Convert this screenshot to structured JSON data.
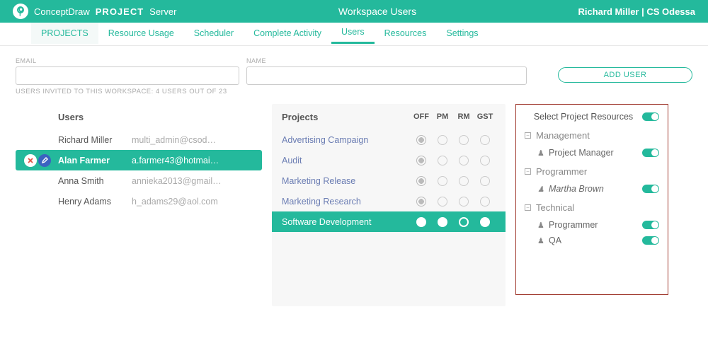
{
  "brand": {
    "left": "ConceptDraw",
    "mid": "PROJECT",
    "right": "Server"
  },
  "page_title": "Workspace Users",
  "current_user": "Richard Miller | CS Odessa",
  "tabs": [
    "PROJECTS",
    "Resource Usage",
    "Scheduler",
    "Complete Activity",
    "Users",
    "Resources",
    "Settings"
  ],
  "labels": {
    "email": "EMAIL",
    "name": "NAME",
    "add_user": "ADD USER"
  },
  "invited": "USERS INVITED TO THIS WORKSPACE: 4 USERS OUT OF 23",
  "users_header": "Users",
  "users": [
    {
      "name": "Richard Miller",
      "email": "multi_admin@csod…",
      "selected": false
    },
    {
      "name": "Alan Farmer",
      "email": "a.farmer43@hotmai…",
      "selected": true
    },
    {
      "name": "Anna Smith",
      "email": "annieka2013@gmail…",
      "selected": false
    },
    {
      "name": "Henry Adams",
      "email": "h_adams29@aol.com",
      "selected": false
    }
  ],
  "projects_header": "Projects",
  "proj_cols": [
    "OFF",
    "PM",
    "RM",
    "GST"
  ],
  "projects": [
    {
      "name": "Advertising Campaign",
      "selected": false,
      "role": "OFF"
    },
    {
      "name": "Audit",
      "selected": false,
      "role": "OFF"
    },
    {
      "name": "Marketing Release",
      "selected": false,
      "role": "OFF"
    },
    {
      "name": "Marketing Research",
      "selected": false,
      "role": "OFF"
    },
    {
      "name": "Software Development",
      "selected": true,
      "role": "RM"
    }
  ],
  "resources": {
    "title": "Select Project Resources",
    "groups": [
      {
        "name": "Management",
        "items": [
          {
            "name": "Project Manager",
            "on": true,
            "italic": false
          }
        ]
      },
      {
        "name": "Programmer",
        "items": [
          {
            "name": "Martha Brown",
            "on": true,
            "italic": true
          }
        ]
      },
      {
        "name": "Technical",
        "items": [
          {
            "name": "Programmer",
            "on": true,
            "italic": false
          },
          {
            "name": "QA",
            "on": true,
            "italic": false
          }
        ]
      }
    ]
  }
}
